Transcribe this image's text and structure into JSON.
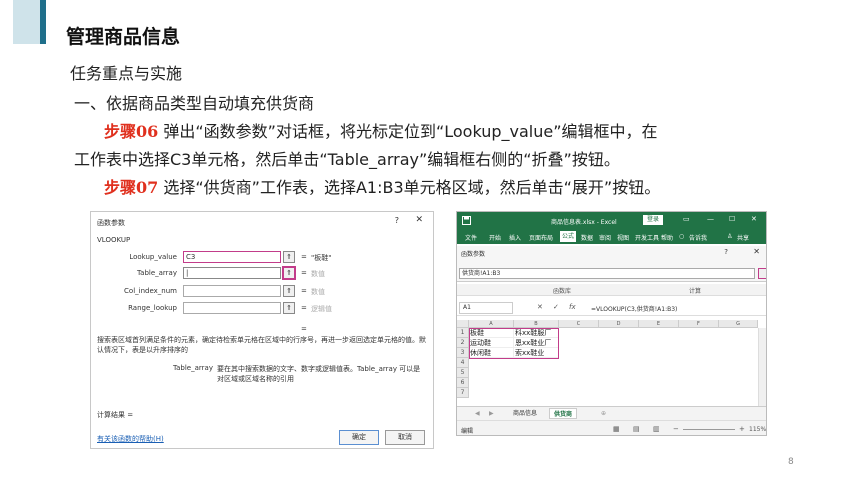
{
  "slide": {
    "title": "管理商品信息",
    "subtitle": "任务重点与实施",
    "section": "一、依据商品类型自动填充供货商",
    "step06_label": "步骤06",
    "step06_text": " 弹出“函数参数”对话框，将光标定位到“Lookup_value”编辑框中，在",
    "step06_text2": "工作表中选择C3单元格，然后单击“Table_array”编辑框右侧的“折叠”按钮。",
    "step07_label": "步骤07",
    "step07_text": " 选择“供货商”工作表，选择A1:B3单元格区域，然后单击“展开”按钮。",
    "page_number": "8"
  },
  "dialog": {
    "title": "函数参数",
    "help": "?",
    "close": "✕",
    "function_name": "VLOOKUP",
    "args": [
      {
        "label": "Lookup_value",
        "value": "C3",
        "result": "\"板鞋\""
      },
      {
        "label": "Table_array",
        "value": "|",
        "result": "数值"
      },
      {
        "label": "Col_index_num",
        "value": "",
        "result": "数值"
      },
      {
        "label": "Range_lookup",
        "value": "",
        "result": "逻辑值"
      }
    ],
    "equals": "=",
    "collapse_glyph": "⇑",
    "description": "搜索表区域首列满足条件的元素，确定待检索单元格在区域中的行序号，再进一步返回选定单元格的值。默认情况下，表是以升序排序的",
    "arg_help_name": "Table_array",
    "arg_help_text": "要在其中搜索数据的文字、数字或逻辑值表。Table_array 可以是对区域或区域名称的引用",
    "result_label": "计算结果 =",
    "help_link": "有关该函数的帮助(H)",
    "ok": "确定",
    "cancel": "取消"
  },
  "excel": {
    "filename": "商品信息表.xlsx - Excel",
    "login": "登录",
    "window_controls": [
      "▭",
      "—",
      "☐",
      "✕"
    ],
    "tabs": [
      "文件",
      "开始",
      "插入",
      "页面布局",
      "公式",
      "数据",
      "审阅",
      "视图",
      "开发工具",
      "帮助",
      "告诉我"
    ],
    "active_tab": "公式",
    "share": "共享",
    "mini_dialog_title": "函数参数",
    "mini_help": "?",
    "mini_close": "✕",
    "mini_input": "供货商!A1:B3",
    "group_labels": [
      "函数库",
      "计算"
    ],
    "name_box": "A1",
    "formula_icons": [
      "✕",
      "✓",
      "fx"
    ],
    "formula": "=VLOOKUP(C3,供货商!A1:B3)",
    "columns": [
      "A",
      "B",
      "C",
      "D",
      "E",
      "F",
      "G"
    ],
    "rows": [
      "1",
      "2",
      "3",
      "4",
      "5",
      "6",
      "7"
    ],
    "cells": [
      [
        "板鞋",
        "科xx鞋服厂"
      ],
      [
        "运动鞋",
        "恩xx鞋业厂"
      ],
      [
        "休闲鞋",
        "索xx鞋业"
      ]
    ],
    "sheets": [
      "商品信息",
      "供货商"
    ],
    "active_sheet": "供货商",
    "status": "编辑",
    "zoom": "115%"
  }
}
